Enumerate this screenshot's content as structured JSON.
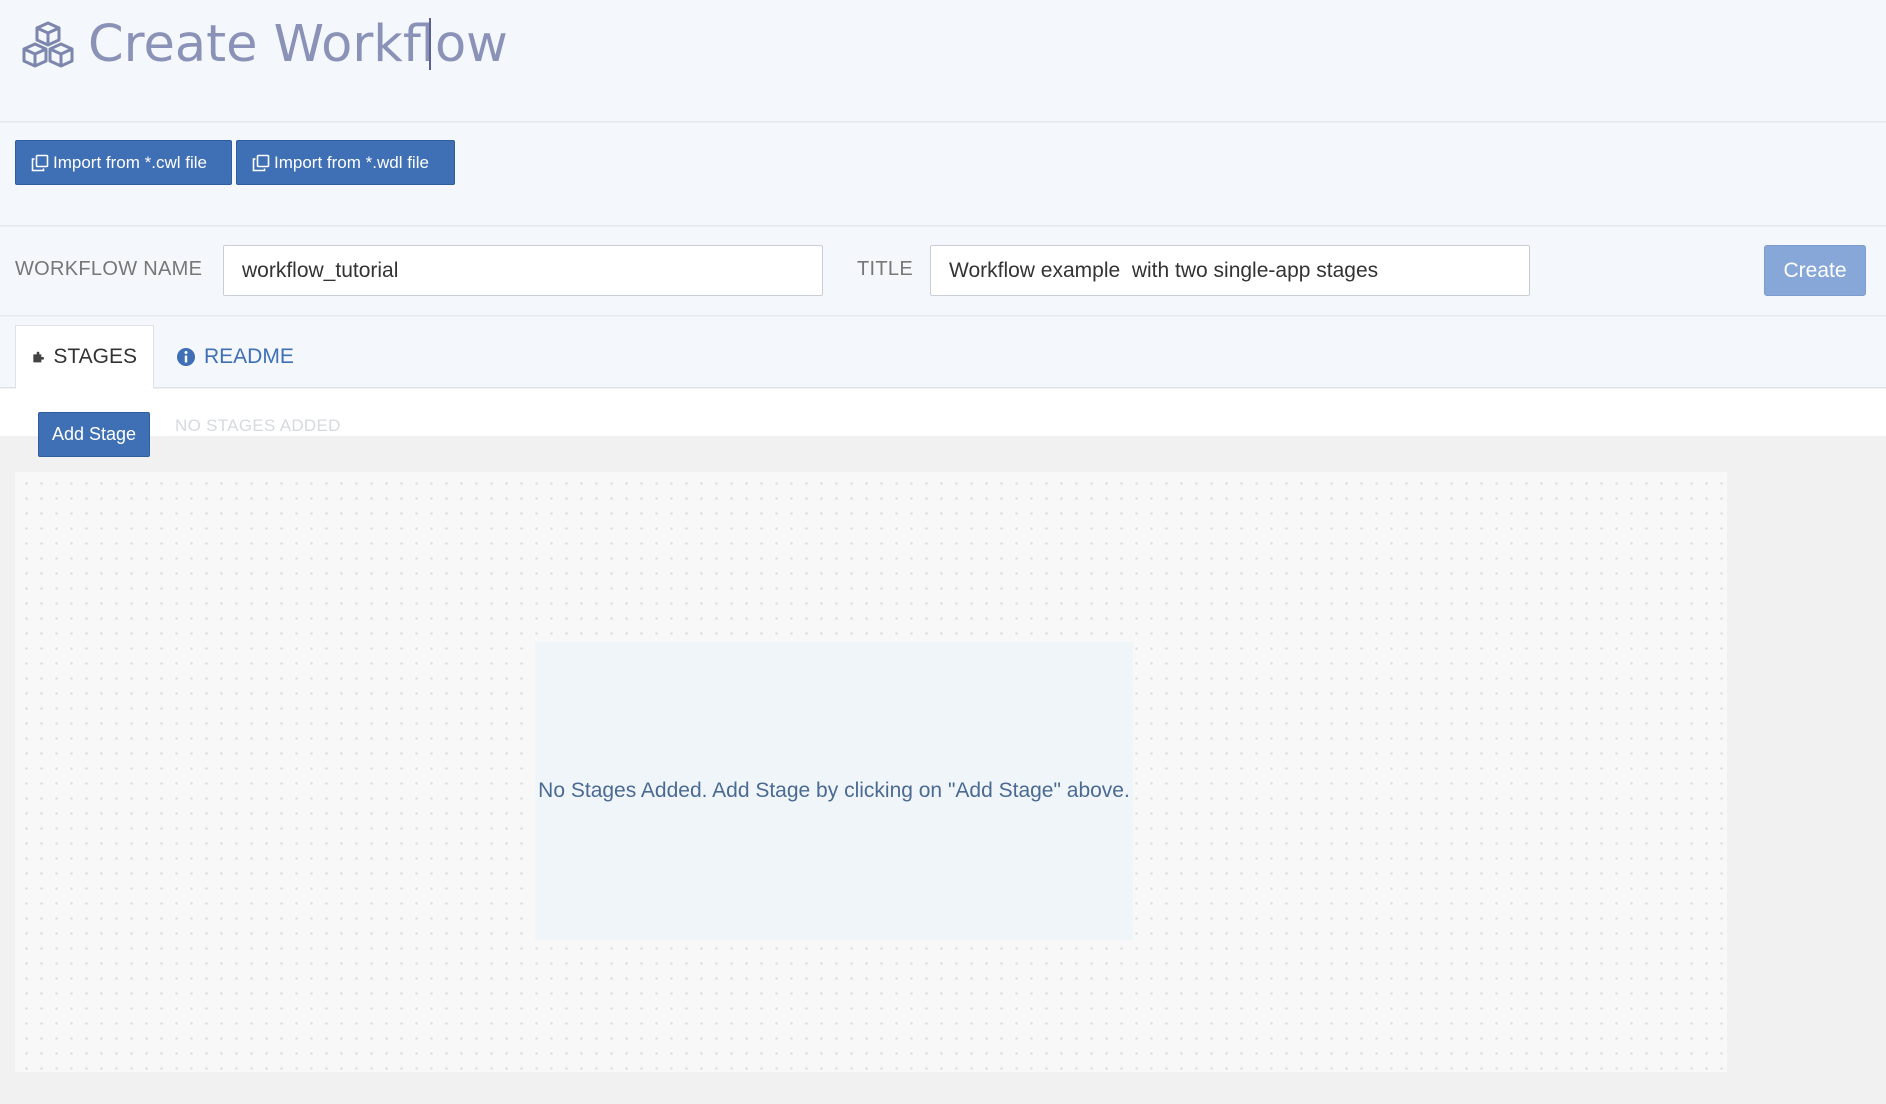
{
  "header": {
    "title": "Create Workflow",
    "icon": "cubes-icon"
  },
  "imports": {
    "cwl_label": "Import from *.cwl file",
    "wdl_label": "Import from *.wdl file",
    "icon": "copy-icon"
  },
  "form": {
    "workflow_name_label": "WORKFLOW NAME",
    "workflow_name_value": "workflow_tutorial",
    "title_label": "TITLE",
    "title_value": "Workflow example  with two single-app stages",
    "create_label": "Create"
  },
  "tabs": [
    {
      "label": "STAGES",
      "icon": "puzzle-icon",
      "active": true
    },
    {
      "label": "README",
      "icon": "info-circle-icon",
      "active": false
    }
  ],
  "stages": {
    "add_stage_label": "Add Stage",
    "hint": "NO STAGES ADDED",
    "empty_message": "No Stages Added. Add Stage by clicking on \"Add Stage\" above."
  },
  "colors": {
    "primary": "#3f6fb4",
    "create_disabled": "#87a7d8",
    "title_text": "#8b92b8",
    "header_bg": "#f4f7fb"
  }
}
